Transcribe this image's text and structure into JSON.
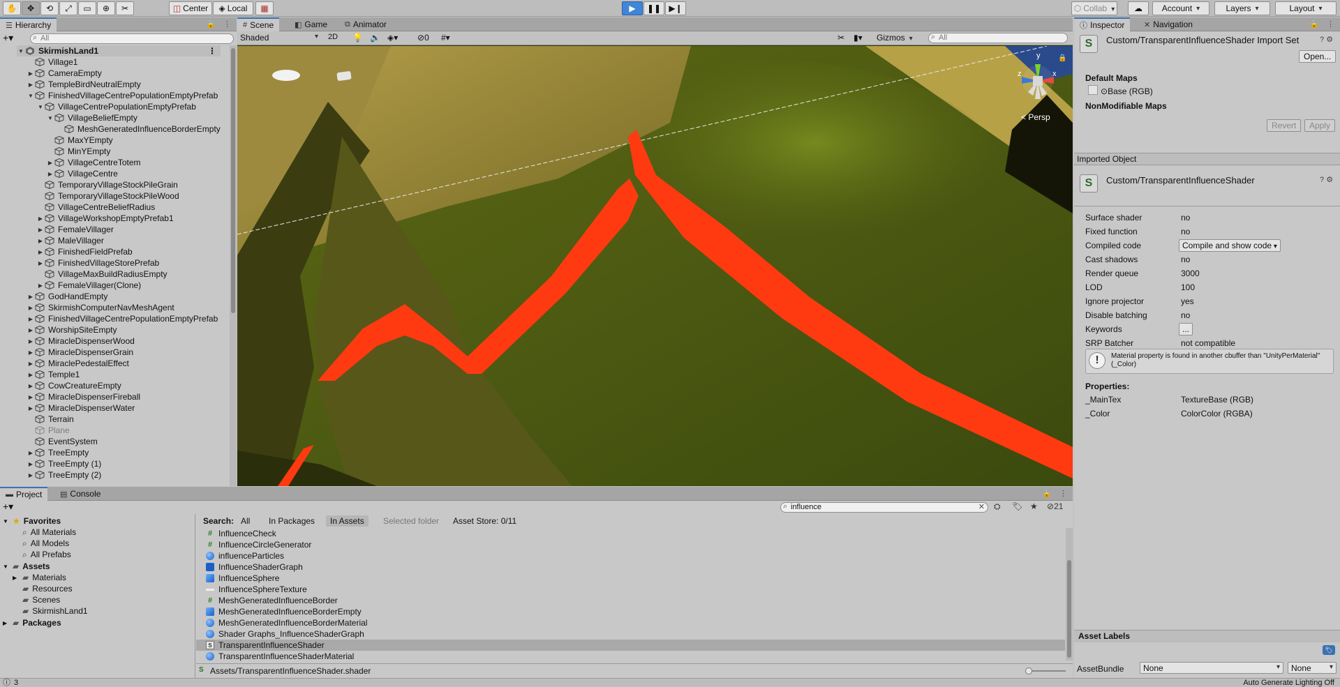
{
  "toolbar": {
    "pivot": "Center",
    "space": "Local",
    "collab": "Collab",
    "account": "Account",
    "layers": "Layers",
    "layout": "Layout"
  },
  "hierarchy": {
    "tab": "Hierarchy",
    "search_placeholder": "All",
    "rows": [
      {
        "label": "SkirmishLand1",
        "indent": 0,
        "arrow": "open",
        "bold": true
      },
      {
        "label": "Village1",
        "indent": 1,
        "arrow": ""
      },
      {
        "label": "CameraEmpty",
        "indent": 1,
        "arrow": "closed"
      },
      {
        "label": "TempleBirdNeutralEmpty",
        "indent": 1,
        "arrow": "closed"
      },
      {
        "label": "FinishedVillageCentrePopulationEmptyPrefab",
        "indent": 1,
        "arrow": "open"
      },
      {
        "label": "VillageCentrePopulationEmptyPrefab",
        "indent": 2,
        "arrow": "open"
      },
      {
        "label": "VillageBeliefEmpty",
        "indent": 3,
        "arrow": "open"
      },
      {
        "label": "MeshGeneratedInfluenceBorderEmpty",
        "indent": 4,
        "arrow": ""
      },
      {
        "label": "MaxYEmpty",
        "indent": 3,
        "arrow": ""
      },
      {
        "label": "MinYEmpty",
        "indent": 3,
        "arrow": ""
      },
      {
        "label": "VillageCentreTotem",
        "indent": 3,
        "arrow": "closed"
      },
      {
        "label": "VillageCentre",
        "indent": 3,
        "arrow": "closed"
      },
      {
        "label": "TemporaryVillageStockPileGrain",
        "indent": 2,
        "arrow": ""
      },
      {
        "label": "TemporaryVillageStockPileWood",
        "indent": 2,
        "arrow": ""
      },
      {
        "label": "VillageCentreBeliefRadius",
        "indent": 2,
        "arrow": ""
      },
      {
        "label": "VillageWorkshopEmptyPrefab1",
        "indent": 2,
        "arrow": "closed"
      },
      {
        "label": "FemaleVillager",
        "indent": 2,
        "arrow": "closed"
      },
      {
        "label": "MaleVillager",
        "indent": 2,
        "arrow": "closed"
      },
      {
        "label": "FinishedFieldPrefab",
        "indent": 2,
        "arrow": "closed"
      },
      {
        "label": "FinishedVillageStorePrefab",
        "indent": 2,
        "arrow": "closed"
      },
      {
        "label": "VillageMaxBuildRadiusEmpty",
        "indent": 2,
        "arrow": ""
      },
      {
        "label": "FemaleVillager(Clone)",
        "indent": 2,
        "arrow": "closed"
      },
      {
        "label": "GodHandEmpty",
        "indent": 1,
        "arrow": "closed"
      },
      {
        "label": "SkirmishComputerNavMeshAgent",
        "indent": 1,
        "arrow": "closed"
      },
      {
        "label": "FinishedVillageCentrePopulationEmptyPrefab",
        "indent": 1,
        "arrow": "closed"
      },
      {
        "label": "WorshipSiteEmpty",
        "indent": 1,
        "arrow": "closed"
      },
      {
        "label": "MiracleDispenserWood",
        "indent": 1,
        "arrow": "closed"
      },
      {
        "label": "MiracleDispenserGrain",
        "indent": 1,
        "arrow": "closed"
      },
      {
        "label": "MiraclePedestalEffect",
        "indent": 1,
        "arrow": "closed"
      },
      {
        "label": "Temple1",
        "indent": 1,
        "arrow": "closed"
      },
      {
        "label": "CowCreatureEmpty",
        "indent": 1,
        "arrow": "closed"
      },
      {
        "label": "MiracleDispenserFireball",
        "indent": 1,
        "arrow": "closed"
      },
      {
        "label": "MiracleDispenserWater",
        "indent": 1,
        "arrow": "closed"
      },
      {
        "label": "Terrain",
        "indent": 1,
        "arrow": ""
      },
      {
        "label": "Plane",
        "indent": 1,
        "arrow": "",
        "faded": true
      },
      {
        "label": "EventSystem",
        "indent": 1,
        "arrow": ""
      },
      {
        "label": "TreeEmpty",
        "indent": 1,
        "arrow": "closed"
      },
      {
        "label": "TreeEmpty (1)",
        "indent": 1,
        "arrow": "closed"
      },
      {
        "label": "TreeEmpty (2)",
        "indent": 1,
        "arrow": "closed"
      }
    ]
  },
  "scene": {
    "tabs": [
      "Scene",
      "Game",
      "Animator"
    ],
    "shading": "Shaded",
    "mode_2d": "2D",
    "hidden_count": "0",
    "gizmos": "Gizmos",
    "search_placeholder": "All",
    "persp": "Persp",
    "axes": {
      "y": "y",
      "x": "x",
      "z": "z"
    },
    "terrain_colors": {
      "grass": "#4f5a12",
      "sand": "#a89345",
      "border": "#ff3a10",
      "water": "#2a4a8c"
    }
  },
  "inspector": {
    "tabs": [
      "Inspector",
      "Navigation"
    ],
    "title": "Custom/TransparentInfluenceShader Import Set",
    "open_button": "Open...",
    "default_maps": "Default Maps",
    "base_map": "Base (RGB)",
    "nonmodifiable": "NonModifiable Maps",
    "revert": "Revert",
    "apply": "Apply",
    "imported_object": "Imported Object",
    "shader_name": "Custom/TransparentInfluenceShader",
    "props": [
      {
        "label": "Surface shader",
        "value": "no"
      },
      {
        "label": "Fixed function",
        "value": "no"
      },
      {
        "label": "Compiled code",
        "value": "Compile and show code",
        "button": true
      },
      {
        "label": "Cast shadows",
        "value": "no"
      },
      {
        "label": "Render queue",
        "value": "3000"
      },
      {
        "label": "LOD",
        "value": "100"
      },
      {
        "label": "Ignore projector",
        "value": "yes"
      },
      {
        "label": "Disable batching",
        "value": "no"
      },
      {
        "label": "Keywords",
        "value": "...",
        "button": true
      },
      {
        "label": "SRP Batcher",
        "value": "not compatible"
      }
    ],
    "warning": "Material property is found in another cbuffer than \"UnityPerMaterial\" (_Color)",
    "properties_header": "Properties:",
    "shader_props": [
      {
        "label": "_MainTex",
        "value": "TextureBase (RGB)"
      },
      {
        "label": "_Color",
        "value": "ColorColor (RGBA)"
      }
    ],
    "asset_labels": "Asset Labels",
    "asset_bundle": "AssetBundle",
    "bundle_value": "None",
    "bundle_variant": "None"
  },
  "project": {
    "tabs": [
      "Project",
      "Console"
    ],
    "search_value": "influence",
    "count": "21",
    "search_label": "Search:",
    "filters": [
      {
        "label": "All"
      },
      {
        "label": "In Packages"
      },
      {
        "label": "In Assets",
        "on": true
      },
      {
        "label": "Selected folder",
        "faded": true
      },
      {
        "label": "Asset Store: 0/11"
      }
    ],
    "favorites": {
      "title": "Favorites",
      "items": [
        "All Materials",
        "All Models",
        "All Prefabs"
      ]
    },
    "assets": {
      "title": "Assets",
      "folders": [
        "Materials",
        "Resources",
        "Scenes",
        "SkirmishLand1"
      ]
    },
    "packages": "Packages",
    "items": [
      {
        "label": "InfluenceCheck",
        "icon": "hash"
      },
      {
        "label": "InfluenceCircleGenerator",
        "icon": "hash"
      },
      {
        "label": "influenceParticles",
        "icon": "sphere"
      },
      {
        "label": "InfluenceShaderGraph",
        "icon": "graph"
      },
      {
        "label": "InfluenceSphere",
        "icon": "cube"
      },
      {
        "label": "InfluenceSphereTexture",
        "icon": "tex"
      },
      {
        "label": "MeshGeneratedInfluenceBorder",
        "icon": "hash"
      },
      {
        "label": "MeshGeneratedInfluenceBorderEmpty",
        "icon": "cube"
      },
      {
        "label": "MeshGeneratedInfluenceBorderMaterial",
        "icon": "sphere"
      },
      {
        "label": "Shader Graphs_InfluenceShaderGraph",
        "icon": "sphere"
      },
      {
        "label": "TransparentInfluenceShader",
        "icon": "shader",
        "selected": true
      },
      {
        "label": "TransparentInfluenceShaderMaterial",
        "icon": "sphere"
      }
    ],
    "path": "Assets/TransparentInfluenceShader.shader"
  },
  "status": {
    "left": "3",
    "right": "Auto Generate Lighting Off"
  }
}
